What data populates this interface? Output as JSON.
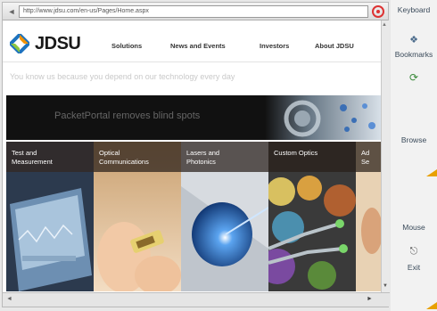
{
  "browser": {
    "url": "http://www.jdsu.com/en-us/Pages/Home.aspx",
    "back_icon": "back-arrow-icon",
    "stop_icon": "stop-icon"
  },
  "site": {
    "logo_text": "JDSU",
    "nav": [
      "Solutions",
      "News and Events",
      "Investors",
      "About JDSU"
    ],
    "tagline": "You know us because you depend on our technology every day",
    "hero_text": "PacketPortal removes blind spots",
    "cards": [
      {
        "label": "Test and Measurement"
      },
      {
        "label": "Optical Communications"
      },
      {
        "label": "Lasers and Photonics"
      },
      {
        "label": "Custom Optics"
      },
      {
        "label": "Ad Se"
      }
    ]
  },
  "side_panel": {
    "keyboard": "Keyboard",
    "bookmarks": "Bookmarks",
    "browse": "Browse",
    "mouse": "Mouse",
    "exit": "Exit"
  },
  "colors": {
    "accent": "#e8a000",
    "logo_blue": "#1e73be",
    "logo_orange": "#f39200"
  }
}
